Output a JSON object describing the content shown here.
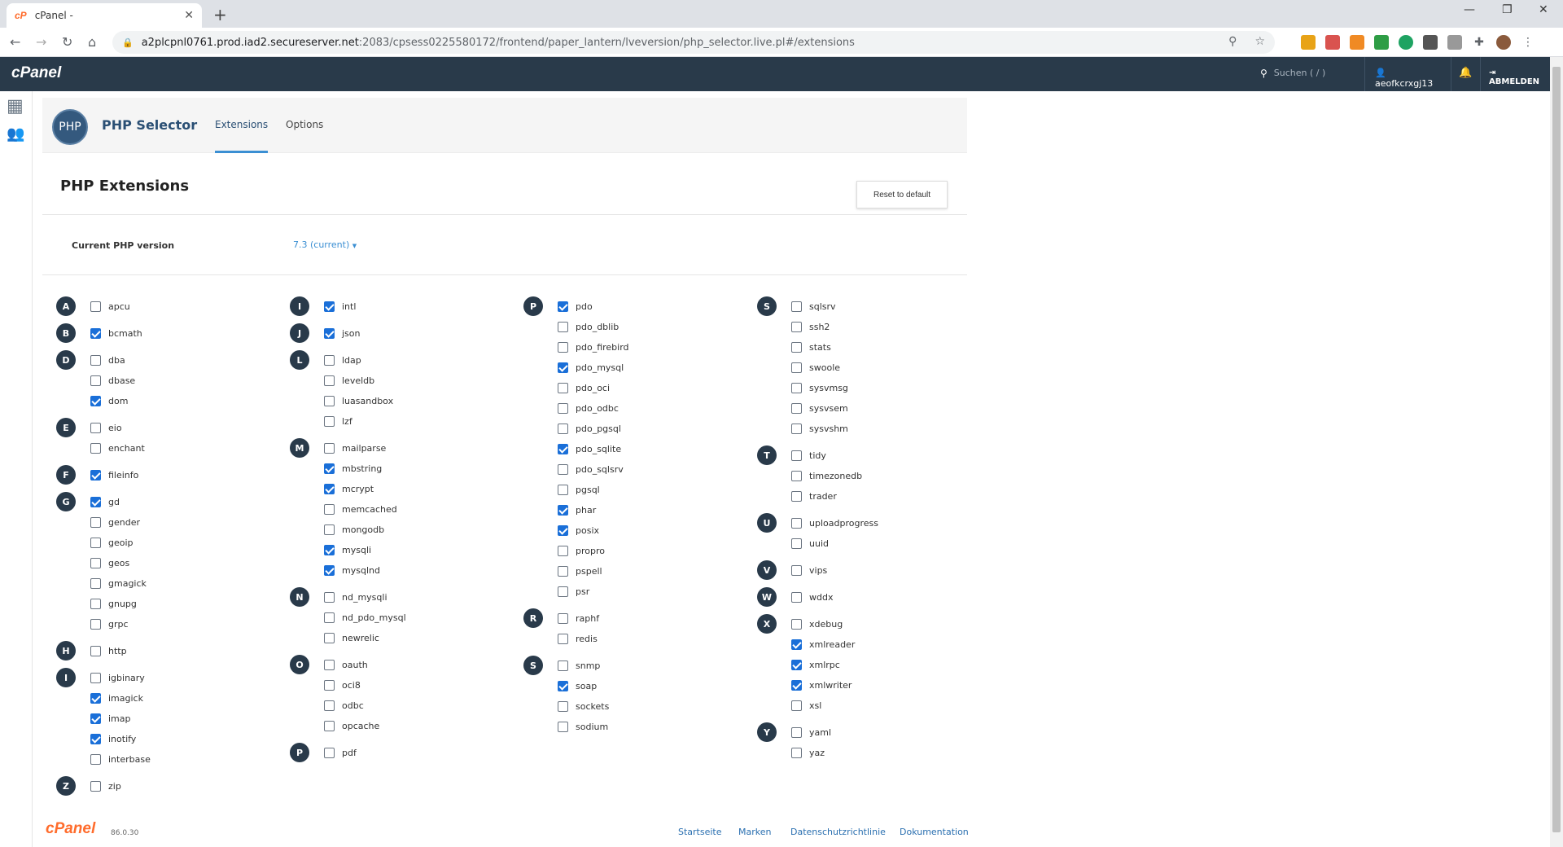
{
  "browser": {
    "tab_title": "cPanel -",
    "tab_favicon": "cP",
    "url_host": "a2plcpnl0761.prod.iad2.secureserver.net",
    "url_path": ":2083/cpsess0225580172/frontend/paper_lantern/lveversion/php_selector.live.pl#/extensions"
  },
  "header": {
    "logo": "cPanel",
    "search_placeholder": "Suchen ( / )",
    "username": "aeofkcrxgj13",
    "logout_label": "ABMELDEN"
  },
  "app": {
    "logo_text": "PHP",
    "title": "PHP Selector",
    "tabs": [
      {
        "label": "Extensions",
        "active": true
      },
      {
        "label": "Options",
        "active": false
      }
    ]
  },
  "page": {
    "title": "PHP Extensions",
    "reset_label": "Reset to default",
    "version_label": "Current PHP version",
    "version_value": "7.3 (current)"
  },
  "columns": [
    [
      {
        "letter": "A",
        "items": [
          {
            "name": "apcu",
            "checked": false
          }
        ]
      },
      {
        "letter": "B",
        "items": [
          {
            "name": "bcmath",
            "checked": true
          }
        ]
      },
      {
        "letter": "D",
        "items": [
          {
            "name": "dba",
            "checked": false
          },
          {
            "name": "dbase",
            "checked": false
          },
          {
            "name": "dom",
            "checked": true
          }
        ]
      },
      {
        "letter": "E",
        "items": [
          {
            "name": "eio",
            "checked": false
          },
          {
            "name": "enchant",
            "checked": false
          }
        ]
      },
      {
        "letter": "F",
        "items": [
          {
            "name": "fileinfo",
            "checked": true
          }
        ]
      },
      {
        "letter": "G",
        "items": [
          {
            "name": "gd",
            "checked": true
          },
          {
            "name": "gender",
            "checked": false
          },
          {
            "name": "geoip",
            "checked": false
          },
          {
            "name": "geos",
            "checked": false
          },
          {
            "name": "gmagick",
            "checked": false
          },
          {
            "name": "gnupg",
            "checked": false
          },
          {
            "name": "grpc",
            "checked": false
          }
        ]
      },
      {
        "letter": "H",
        "items": [
          {
            "name": "http",
            "checked": false
          }
        ]
      },
      {
        "letter": "I",
        "items": [
          {
            "name": "igbinary",
            "checked": false
          },
          {
            "name": "imagick",
            "checked": true
          },
          {
            "name": "imap",
            "checked": true
          },
          {
            "name": "inotify",
            "checked": true
          },
          {
            "name": "interbase",
            "checked": false
          }
        ]
      },
      {
        "letter": "Z",
        "items": [
          {
            "name": "zip",
            "checked": false
          }
        ]
      }
    ],
    [
      {
        "letter": "I",
        "items": [
          {
            "name": "intl",
            "checked": true
          }
        ]
      },
      {
        "letter": "J",
        "items": [
          {
            "name": "json",
            "checked": true
          }
        ]
      },
      {
        "letter": "L",
        "items": [
          {
            "name": "ldap",
            "checked": false
          },
          {
            "name": "leveldb",
            "checked": false
          },
          {
            "name": "luasandbox",
            "checked": false
          },
          {
            "name": "lzf",
            "checked": false
          }
        ]
      },
      {
        "letter": "M",
        "items": [
          {
            "name": "mailparse",
            "checked": false
          },
          {
            "name": "mbstring",
            "checked": true
          },
          {
            "name": "mcrypt",
            "checked": true
          },
          {
            "name": "memcached",
            "checked": false
          },
          {
            "name": "mongodb",
            "checked": false
          },
          {
            "name": "mysqli",
            "checked": true
          },
          {
            "name": "mysqlnd",
            "checked": true
          }
        ]
      },
      {
        "letter": "N",
        "items": [
          {
            "name": "nd_mysqli",
            "checked": false
          },
          {
            "name": "nd_pdo_mysql",
            "checked": false
          },
          {
            "name": "newrelic",
            "checked": false
          }
        ]
      },
      {
        "letter": "O",
        "items": [
          {
            "name": "oauth",
            "checked": false
          },
          {
            "name": "oci8",
            "checked": false
          },
          {
            "name": "odbc",
            "checked": false
          },
          {
            "name": "opcache",
            "checked": false
          }
        ]
      },
      {
        "letter": "P",
        "items": [
          {
            "name": "pdf",
            "checked": false
          }
        ]
      }
    ],
    [
      {
        "letter": "P",
        "items": [
          {
            "name": "pdo",
            "checked": true
          },
          {
            "name": "pdo_dblib",
            "checked": false
          },
          {
            "name": "pdo_firebird",
            "checked": false
          },
          {
            "name": "pdo_mysql",
            "checked": true
          },
          {
            "name": "pdo_oci",
            "checked": false
          },
          {
            "name": "pdo_odbc",
            "checked": false
          },
          {
            "name": "pdo_pgsql",
            "checked": false
          },
          {
            "name": "pdo_sqlite",
            "checked": true
          },
          {
            "name": "pdo_sqlsrv",
            "checked": false
          },
          {
            "name": "pgsql",
            "checked": false
          },
          {
            "name": "phar",
            "checked": true
          },
          {
            "name": "posix",
            "checked": true
          },
          {
            "name": "propro",
            "checked": false
          },
          {
            "name": "pspell",
            "checked": false
          },
          {
            "name": "psr",
            "checked": false
          }
        ]
      },
      {
        "letter": "R",
        "items": [
          {
            "name": "raphf",
            "checked": false
          },
          {
            "name": "redis",
            "checked": false
          }
        ]
      },
      {
        "letter": "S",
        "items": [
          {
            "name": "snmp",
            "checked": false
          },
          {
            "name": "soap",
            "checked": true
          },
          {
            "name": "sockets",
            "checked": false
          },
          {
            "name": "sodium",
            "checked": false
          }
        ]
      }
    ],
    [
      {
        "letter": "S",
        "items": [
          {
            "name": "sqlsrv",
            "checked": false
          },
          {
            "name": "ssh2",
            "checked": false
          },
          {
            "name": "stats",
            "checked": false
          },
          {
            "name": "swoole",
            "checked": false
          },
          {
            "name": "sysvmsg",
            "checked": false
          },
          {
            "name": "sysvsem",
            "checked": false
          },
          {
            "name": "sysvshm",
            "checked": false
          }
        ]
      },
      {
        "letter": "T",
        "items": [
          {
            "name": "tidy",
            "checked": false
          },
          {
            "name": "timezonedb",
            "checked": false
          },
          {
            "name": "trader",
            "checked": false
          }
        ]
      },
      {
        "letter": "U",
        "items": [
          {
            "name": "uploadprogress",
            "checked": false
          },
          {
            "name": "uuid",
            "checked": false
          }
        ]
      },
      {
        "letter": "V",
        "items": [
          {
            "name": "vips",
            "checked": false
          }
        ]
      },
      {
        "letter": "W",
        "items": [
          {
            "name": "wddx",
            "checked": false
          }
        ]
      },
      {
        "letter": "X",
        "items": [
          {
            "name": "xdebug",
            "checked": false
          },
          {
            "name": "xmlreader",
            "checked": true
          },
          {
            "name": "xmlrpc",
            "checked": true
          },
          {
            "name": "xmlwriter",
            "checked": true
          },
          {
            "name": "xsl",
            "checked": false
          }
        ]
      },
      {
        "letter": "Y",
        "items": [
          {
            "name": "yaml",
            "checked": false
          },
          {
            "name": "yaz",
            "checked": false
          }
        ]
      }
    ]
  ],
  "footer": {
    "logo": "cPanel",
    "version": "86.0.30",
    "links": [
      "Startseite",
      "Marken",
      "Datenschutzrichtlinie",
      "Dokumentation"
    ]
  }
}
